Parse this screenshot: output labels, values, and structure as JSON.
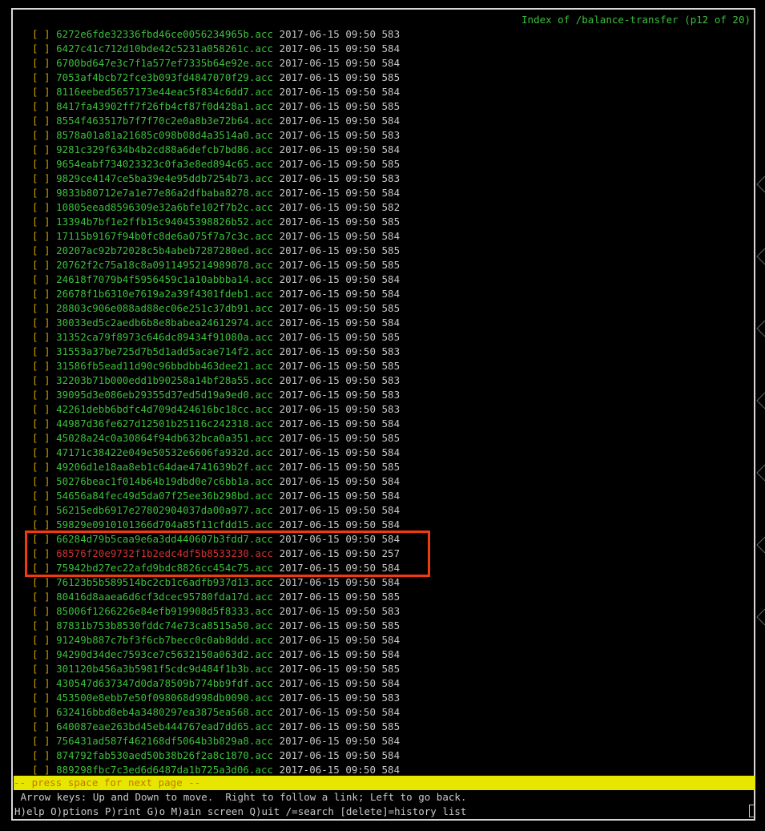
{
  "window": {
    "title": "Index of /balance-transfer (p12 of 20)"
  },
  "checkbox_text": "[ ]",
  "files": [
    {
      "name": "6272e6fde32336fbd46ce0056234965b.acc",
      "date": "2017-06-15 09:50",
      "size": "583"
    },
    {
      "name": "6427c41c712d10bde42c5231a058261c.acc",
      "date": "2017-06-15 09:50",
      "size": "584"
    },
    {
      "name": "6700bd647e3c7f1a577ef7335b64e92e.acc",
      "date": "2017-06-15 09:50",
      "size": "584"
    },
    {
      "name": "7053af4bcb72fce3b093fd4847070f29.acc",
      "date": "2017-06-15 09:50",
      "size": "585"
    },
    {
      "name": "8116eebed5657173e44eac5f834c6dd7.acc",
      "date": "2017-06-15 09:50",
      "size": "584"
    },
    {
      "name": "8417fa43902ff7f26fb4cf87f0d428a1.acc",
      "date": "2017-06-15 09:50",
      "size": "585"
    },
    {
      "name": "8554f463517b7f7f70c2e0a8b3e72b64.acc",
      "date": "2017-06-15 09:50",
      "size": "584"
    },
    {
      "name": "8578a01a81a21685c098b08d4a3514a0.acc",
      "date": "2017-06-15 09:50",
      "size": "583"
    },
    {
      "name": "9281c329f634b4b2cd88a6defcb7bd86.acc",
      "date": "2017-06-15 09:50",
      "size": "584"
    },
    {
      "name": "9654eabf734023323c0fa3e8ed894c65.acc",
      "date": "2017-06-15 09:50",
      "size": "585"
    },
    {
      "name": "9829ce4147ce5ba39e4e95ddb7254b73.acc",
      "date": "2017-06-15 09:50",
      "size": "583"
    },
    {
      "name": "9833b80712e7a1e77e86a2dfbaba8278.acc",
      "date": "2017-06-15 09:50",
      "size": "584"
    },
    {
      "name": "10805eead8596309e32a6bfe102f7b2c.acc",
      "date": "2017-06-15 09:50",
      "size": "582"
    },
    {
      "name": "13394b7bf1e2ffb15c94045398826b52.acc",
      "date": "2017-06-15 09:50",
      "size": "585"
    },
    {
      "name": "17115b9167f94b0fc8de6a075f7a7c3c.acc",
      "date": "2017-06-15 09:50",
      "size": "584"
    },
    {
      "name": "20207ac92b72028c5b4abeb7287280ed.acc",
      "date": "2017-06-15 09:50",
      "size": "585"
    },
    {
      "name": "20762f2c75a18c8a0911495214989878.acc",
      "date": "2017-06-15 09:50",
      "size": "585"
    },
    {
      "name": "24618f7079b4f5956459c1a10abbba14.acc",
      "date": "2017-06-15 09:50",
      "size": "584"
    },
    {
      "name": "26678f1b6310e7619a2a39f4301fdeb1.acc",
      "date": "2017-06-15 09:50",
      "size": "584"
    },
    {
      "name": "28803c906e088ad88ec06e251c37db91.acc",
      "date": "2017-06-15 09:50",
      "size": "585"
    },
    {
      "name": "30033ed5c2aedb6b8e8babea24612974.acc",
      "date": "2017-06-15 09:50",
      "size": "584"
    },
    {
      "name": "31352ca79f8973c646dc89434f91080a.acc",
      "date": "2017-06-15 09:50",
      "size": "585"
    },
    {
      "name": "31553a37be725d7b5d1add5acae714f2.acc",
      "date": "2017-06-15 09:50",
      "size": "583"
    },
    {
      "name": "31586fb5ead11d90c96bbdbb463dee21.acc",
      "date": "2017-06-15 09:50",
      "size": "585"
    },
    {
      "name": "32203b71b000edd1b90258a14bf28a55.acc",
      "date": "2017-06-15 09:50",
      "size": "583"
    },
    {
      "name": "39095d3e086eb29355d37ed5d19a9ed0.acc",
      "date": "2017-06-15 09:50",
      "size": "583"
    },
    {
      "name": "42261debb6bdfc4d709d424616bc18cc.acc",
      "date": "2017-06-15 09:50",
      "size": "583"
    },
    {
      "name": "44987d36fe627d12501b25116c242318.acc",
      "date": "2017-06-15 09:50",
      "size": "584"
    },
    {
      "name": "45028a24c0a30864f94db632bca0a351.acc",
      "date": "2017-06-15 09:50",
      "size": "585"
    },
    {
      "name": "47171c38422e049e50532e6606fa932d.acc",
      "date": "2017-06-15 09:50",
      "size": "584"
    },
    {
      "name": "49206d1e18aa8eb1c64dae4741639b2f.acc",
      "date": "2017-06-15 09:50",
      "size": "585"
    },
    {
      "name": "50276beac1f014b64b19dbd0e7c6bb1a.acc",
      "date": "2017-06-15 09:50",
      "size": "584"
    },
    {
      "name": "54656a84fec49d5da07f25ee36b298bd.acc",
      "date": "2017-06-15 09:50",
      "size": "584"
    },
    {
      "name": "56215edb6917e27802904037da00a977.acc",
      "date": "2017-06-15 09:50",
      "size": "584"
    },
    {
      "name": "59829e0910101366d704a85f11cfdd15.acc",
      "date": "2017-06-15 09:50",
      "size": "584"
    },
    {
      "name": "66284d79b5caa9e6a3dd440607b3fdd7.acc",
      "date": "2017-06-15 09:50",
      "size": "584"
    },
    {
      "name": "68576f20e9732f1b2edc4df5b8533230.acc",
      "date": "2017-06-15 09:50",
      "size": "257",
      "alert": true
    },
    {
      "name": "75942bd27ec22afd9bdc8826cc454c75.acc",
      "date": "2017-06-15 09:50",
      "size": "584"
    },
    {
      "name": "76123b5b589514bc2cb1c6adfb937d13.acc",
      "date": "2017-06-15 09:50",
      "size": "584"
    },
    {
      "name": "80416d8aaea6d6cf3dcec95780fda17d.acc",
      "date": "2017-06-15 09:50",
      "size": "585"
    },
    {
      "name": "85006f1266226e84efb919908d5f8333.acc",
      "date": "2017-06-15 09:50",
      "size": "583"
    },
    {
      "name": "87831b753b8530fddc74e73ca8515a50.acc",
      "date": "2017-06-15 09:50",
      "size": "585"
    },
    {
      "name": "91249b887c7bf3f6cb7becc0c0ab8ddd.acc",
      "date": "2017-06-15 09:50",
      "size": "584"
    },
    {
      "name": "94290d34dec7593ce7c5632150a063d2.acc",
      "date": "2017-06-15 09:50",
      "size": "584"
    },
    {
      "name": "301120b456a3b5981f5cdc9d484f1b3b.acc",
      "date": "2017-06-15 09:50",
      "size": "585"
    },
    {
      "name": "430547d637347d0da78509b774bb9fdf.acc",
      "date": "2017-06-15 09:50",
      "size": "584"
    },
    {
      "name": "453500e8ebb7e50f098068d998db0090.acc",
      "date": "2017-06-15 09:50",
      "size": "583"
    },
    {
      "name": "632416bbd8eb4a3480297ea3875ea568.acc",
      "date": "2017-06-15 09:50",
      "size": "584"
    },
    {
      "name": "640087eae263bd45eb444767ead7dd65.acc",
      "date": "2017-06-15 09:50",
      "size": "585"
    },
    {
      "name": "756431ad587f462168df5064b3b829a8.acc",
      "date": "2017-06-15 09:50",
      "size": "584"
    },
    {
      "name": "874792fab530aed50b38b26f2a8c1870.acc",
      "date": "2017-06-15 09:50",
      "size": "584"
    },
    {
      "name": "889298fbc7c3ed6d6487da1b725a3d06.acc",
      "date": "2017-06-15 09:50",
      "size": "584"
    }
  ],
  "status_bar": {
    "text": "-- press space for next page --"
  },
  "help": {
    "line1": " Arrow keys: Up and Down to move.  Right to follow a link; Left to go back.",
    "line2": "H)elp O)ptions P)rint G)o M)ain screen Q)uit /=search [delete]=history list"
  },
  "colors": {
    "background": "#000000",
    "link": "#3cbf3c",
    "alert_link": "#d03030",
    "checkbox": "#c8a000",
    "status_bar_bg": "#e6e600",
    "highlight_border": "#f03a10"
  }
}
